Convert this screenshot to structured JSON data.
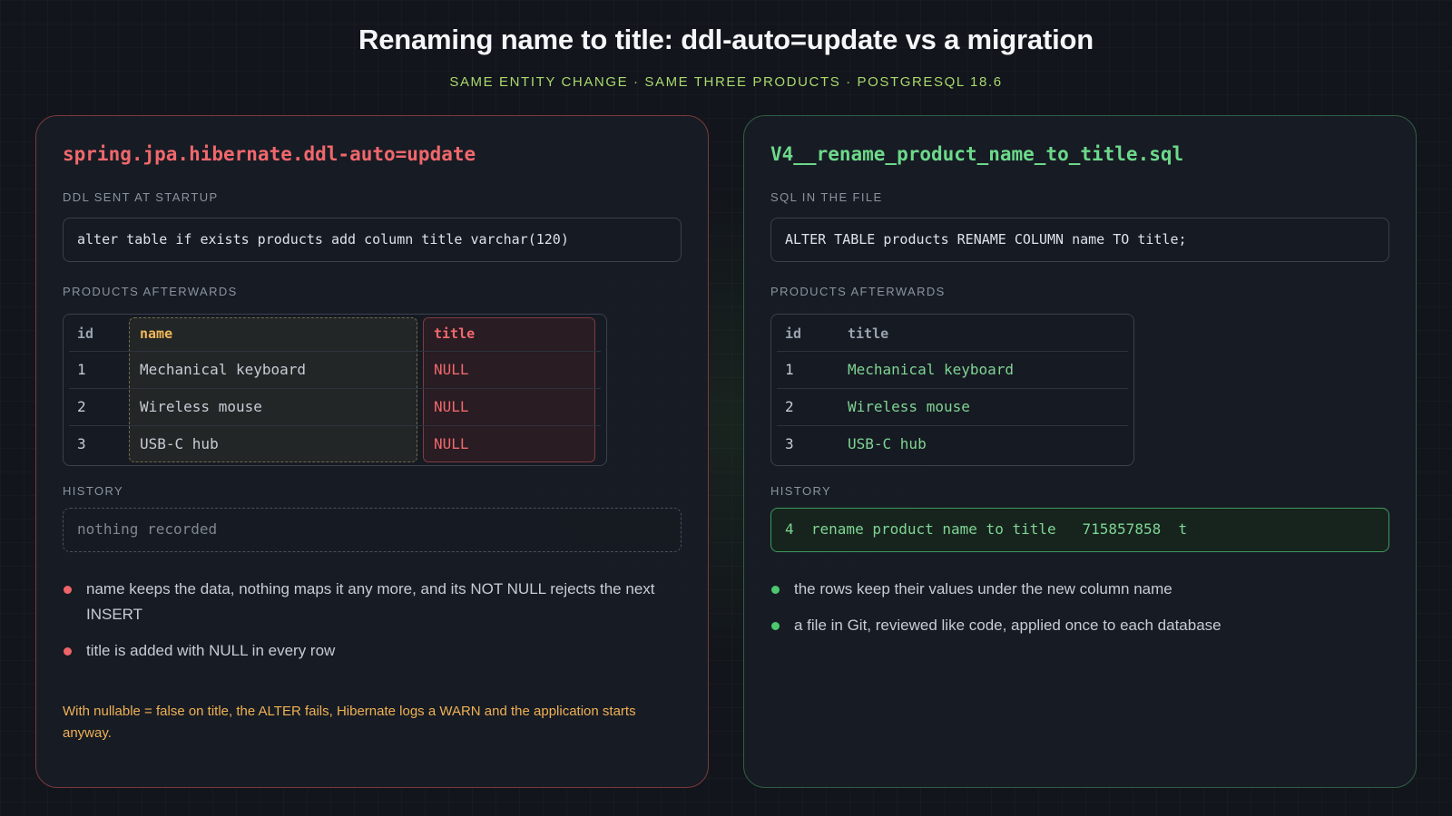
{
  "header": {
    "title": "Renaming name to title: ddl-auto=update vs a migration",
    "subtitle": "SAME ENTITY CHANGE · SAME THREE PRODUCTS · POSTGRESQL 18.6"
  },
  "left": {
    "title": "spring.jpa.hibernate.ddl-auto=update",
    "ddl_label": "DDL SENT AT STARTUP",
    "ddl": "alter table if exists products add column title varchar(120)",
    "products_label": "PRODUCTS AFTERWARDS",
    "columns": [
      "id",
      "name",
      "title"
    ],
    "rows": [
      {
        "id": "1",
        "name": "Mechanical keyboard",
        "title": "NULL"
      },
      {
        "id": "2",
        "name": "Wireless mouse",
        "title": "NULL"
      },
      {
        "id": "3",
        "name": "USB-C hub",
        "title": "NULL"
      }
    ],
    "history_label": "HISTORY",
    "history": "nothing recorded",
    "bullets": [
      "name keeps the data, nothing maps it any more, and its NOT NULL rejects the next INSERT",
      "title is added with NULL in every row"
    ],
    "note": "With nullable = false on title, the ALTER fails, Hibernate logs a WARN and the application starts anyway."
  },
  "right": {
    "title": "V4__rename_product_name_to_title.sql",
    "sql_label": "SQL IN THE FILE",
    "sql": "ALTER TABLE products RENAME COLUMN name TO title;",
    "products_label": "PRODUCTS AFTERWARDS",
    "columns": [
      "id",
      "title"
    ],
    "rows": [
      {
        "id": "1",
        "title": "Mechanical keyboard"
      },
      {
        "id": "2",
        "title": "Wireless mouse"
      },
      {
        "id": "3",
        "title": "USB-C hub"
      }
    ],
    "history_label": "HISTORY",
    "history": "4  rename product name to title   715857858  t",
    "bullets": [
      "the rows keep their values under the new column name",
      "a file in Git, reviewed like code, applied once to each database"
    ]
  },
  "colors": {
    "left_accent": "#f0686c",
    "right_accent": "#6cd98a",
    "subtitle": "#a9d86e",
    "warning": "#efb153"
  }
}
